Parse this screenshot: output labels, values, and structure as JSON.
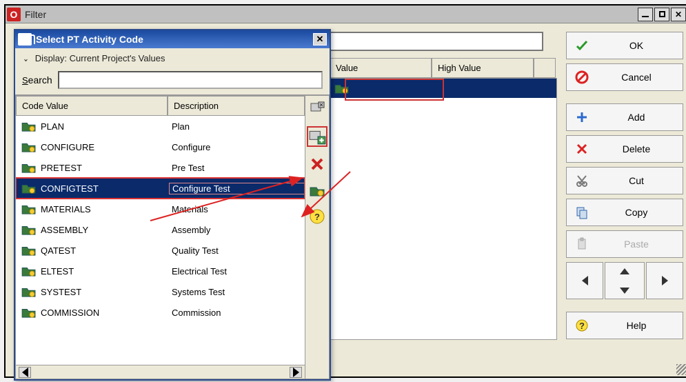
{
  "window": {
    "title": "Filter"
  },
  "grid": {
    "headers": {
      "value": "Value",
      "high_value": "High Value"
    }
  },
  "popup": {
    "title": "Select PT Activity Code",
    "display_line": "Display: Current Project's Values",
    "search_label": "Search",
    "search_value": "",
    "headers": {
      "code": "Code Value",
      "desc": "Description"
    },
    "rows": [
      {
        "code": "PLAN",
        "desc": "Plan"
      },
      {
        "code": "CONFIGURE",
        "desc": "Configure"
      },
      {
        "code": "PRETEST",
        "desc": "Pre Test"
      },
      {
        "code": "CONFIGTEST",
        "desc": "Configure Test"
      },
      {
        "code": "MATERIALS",
        "desc": "Materials"
      },
      {
        "code": "ASSEMBLY",
        "desc": "Assembly"
      },
      {
        "code": "QATEST",
        "desc": "Quality Test"
      },
      {
        "code": "ELTEST",
        "desc": "Electrical Test"
      },
      {
        "code": "SYSTEST",
        "desc": "Systems Test"
      },
      {
        "code": "COMMISSION",
        "desc": "Commission"
      }
    ],
    "selected_index": 3
  },
  "buttons": {
    "ok": "OK",
    "cancel": "Cancel",
    "add": "Add",
    "delete": "Delete",
    "cut": "Cut",
    "copy": "Copy",
    "paste": "Paste",
    "help": "Help"
  },
  "colors": {
    "selection": "#0a2a6a",
    "highlight_box": "#c33"
  }
}
